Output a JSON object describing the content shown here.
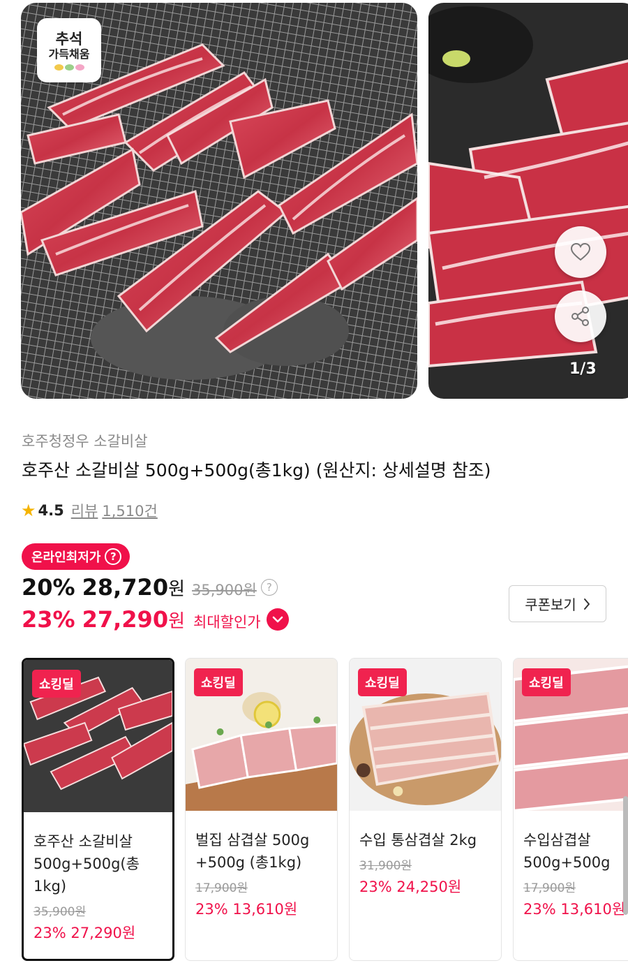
{
  "gallery": {
    "promo_badge": {
      "line1": "추석",
      "line2": "가득채움"
    },
    "page_indicator": "1/3",
    "icons": {
      "like": "heart-icon",
      "share": "share-icon"
    }
  },
  "product": {
    "brand": "호주청정우 소갈비살",
    "title": "호주산 소갈비살 500g+500g(총1kg) (원산지: 상세설명 참조)",
    "rating": "4.5",
    "review_label": "리뷰",
    "review_count": "1,510건"
  },
  "pricing": {
    "lowest_badge": "온라인최저가",
    "price1_rate": "20%",
    "price1_amount": "28,720",
    "price1_unit": "원",
    "price1_original": "35,900원",
    "price2_rate": "23%",
    "price2_amount": "27,290",
    "price2_unit": "원",
    "max_discount_label": "최대할인가",
    "coupon_button": "쿠폰보기",
    "accent_color": "#f0114a"
  },
  "deals": [
    {
      "tag": "쇼킹딜",
      "name": "호주산 소갈비살 500g+500g(총1kg)",
      "original": "35,900원",
      "sale": "23% 27,290원",
      "selected": true
    },
    {
      "tag": "쇼킹딜",
      "name": "벌집 삼겹살 500g +500g (총1kg)",
      "original": "17,900원",
      "sale": "23% 13,610원",
      "selected": false
    },
    {
      "tag": "쇼킹딜",
      "name": "수입 통삼겹살 2kg",
      "original": "31,900원",
      "sale": "23% 24,250원",
      "selected": false
    },
    {
      "tag": "쇼킹딜",
      "name": "수입삼겹살 500g+500g",
      "original": "17,900원",
      "sale": "23% 13,610원",
      "selected": false
    }
  ]
}
